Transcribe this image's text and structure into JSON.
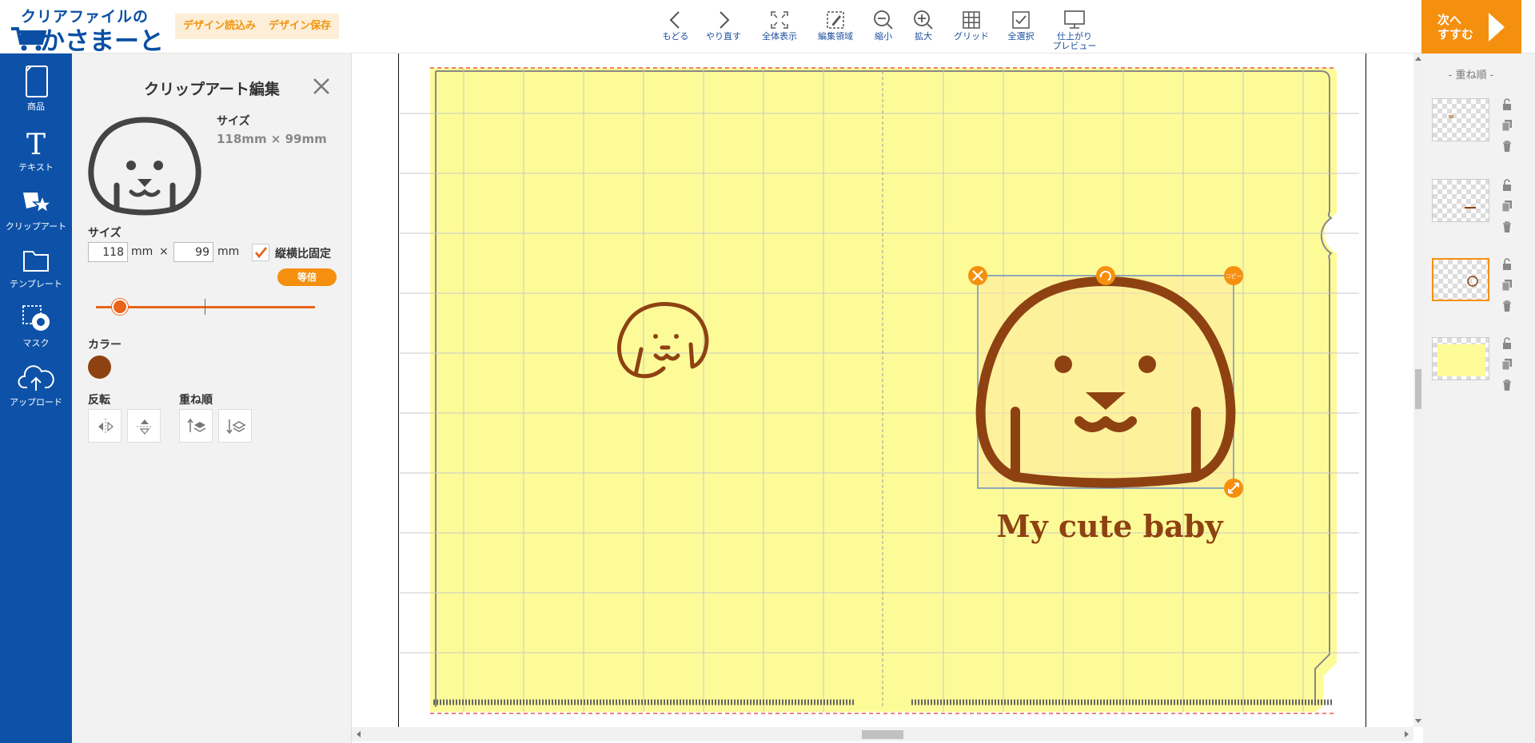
{
  "header": {
    "logo_line1": "クリアファイルの",
    "logo_line2": "かさまーと",
    "load_design": "デザイン読込み",
    "save_design": "デザイン保存",
    "tools": [
      {
        "label": "もどる",
        "icon": "chevron-left-icon"
      },
      {
        "label": "やり直す",
        "icon": "chevron-right-icon"
      },
      {
        "label": "全体表示",
        "icon": "fit-screen-icon"
      },
      {
        "label": "編集領域",
        "icon": "edit-area-icon"
      },
      {
        "label": "縮小",
        "icon": "zoom-out-icon"
      },
      {
        "label": "拡大",
        "icon": "zoom-in-icon"
      },
      {
        "label": "グリッド",
        "icon": "grid-icon"
      },
      {
        "label": "全選択",
        "icon": "select-all-icon"
      },
      {
        "label": "仕上がり\nプレビュー",
        "icon": "monitor-icon"
      }
    ],
    "next_label": "次へ\nすすむ"
  },
  "sidebar": {
    "items": [
      {
        "label": "商品",
        "icon": "product-file-icon"
      },
      {
        "label": "テキスト",
        "icon": "text-icon"
      },
      {
        "label": "クリップアート",
        "icon": "clipart-star-icon"
      },
      {
        "label": "テンプレート",
        "icon": "folder-icon"
      },
      {
        "label": "マスク",
        "icon": "mask-icon"
      },
      {
        "label": "アップロード",
        "icon": "cloud-upload-icon"
      }
    ]
  },
  "panel": {
    "title": "クリップアート編集",
    "size_heading": "サイズ",
    "size_value": "118mm × 99mm",
    "size_label": "サイズ",
    "width_value": "118",
    "height_value": "99",
    "unit_mm": "mm",
    "times": "×",
    "aspect_lock_label": "縦横比固定",
    "aspect_lock_checked": true,
    "scale_button": "等倍",
    "scale_slider_fraction": 0.09,
    "color_label": "カラー",
    "color_value": "#8e4212",
    "flip_label": "反転",
    "order_label": "重ね順"
  },
  "canvas": {
    "file_color": "#fdfb98",
    "text": "My cute baby",
    "handle_copy_label": "コピー"
  },
  "layers": {
    "title": "- 重ね順 -"
  }
}
